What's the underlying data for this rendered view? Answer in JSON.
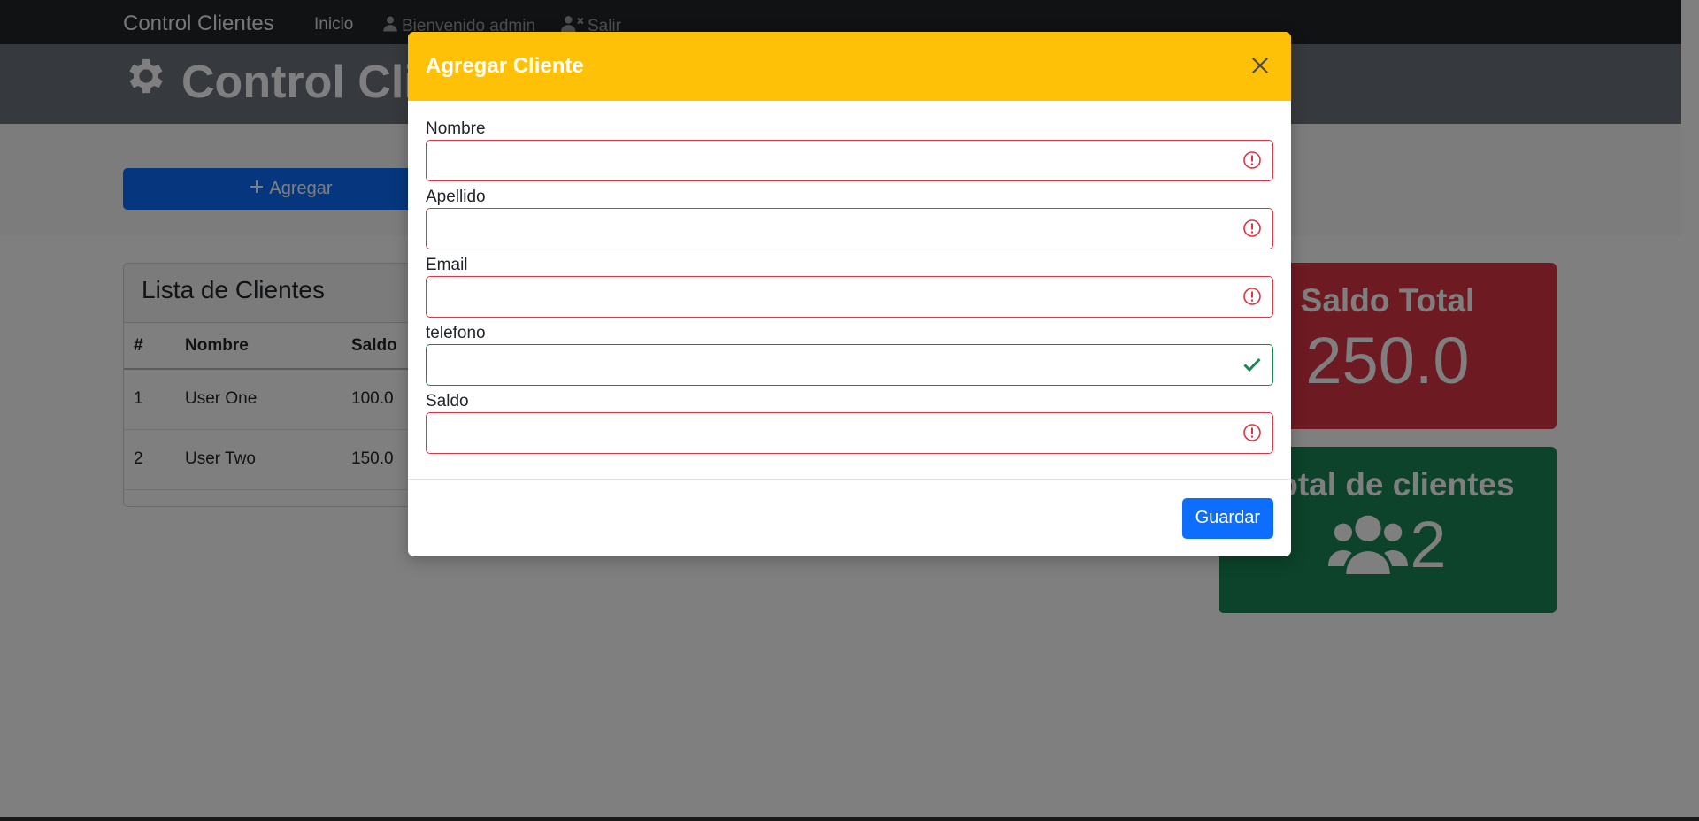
{
  "navbar": {
    "brand": "Control Clientes",
    "home_link": "Inicio",
    "welcome_text": "Bienvenido admin",
    "logout_link": "Salir"
  },
  "header": {
    "title": "Control Clientes"
  },
  "actions": {
    "add_label": "Agregar"
  },
  "clients": {
    "card_title": "Lista de Clientes",
    "columns": [
      "#",
      "Nombre",
      "Saldo"
    ],
    "rows": [
      {
        "num": "1",
        "name": "User One",
        "balance": "100.0"
      },
      {
        "num": "2",
        "name": "User Two",
        "balance": "150.0"
      }
    ]
  },
  "stats": {
    "balance_title": "Saldo Total",
    "balance_value": "250.0",
    "clients_title": "Total de clientes",
    "clients_value": "2"
  },
  "modal": {
    "title": "Agregar Cliente",
    "fields": [
      {
        "label": "Nombre",
        "value": "",
        "state": "invalid"
      },
      {
        "label": "Apellido",
        "value": "",
        "state": "invalid"
      },
      {
        "label": "Email",
        "value": "",
        "state": "invalid"
      },
      {
        "label": "telefono",
        "value": "",
        "state": "valid"
      },
      {
        "label": "Saldo",
        "value": "",
        "state": "invalid"
      }
    ],
    "save_label": "Guardar"
  },
  "colors": {
    "navbar": "#212529",
    "header": "#6c757d",
    "modal_header": "#ffc107",
    "primary": "#0d6efd",
    "danger": "#dc3545",
    "success": "#198754"
  },
  "icons": {
    "header": "gear-icon",
    "welcome": "user-icon",
    "logout": "user-x-icon",
    "add": "plus-icon",
    "clients_stat": "users-icon",
    "close": "close-icon",
    "invalid": "exclamation-circle-icon",
    "valid": "check-icon"
  }
}
